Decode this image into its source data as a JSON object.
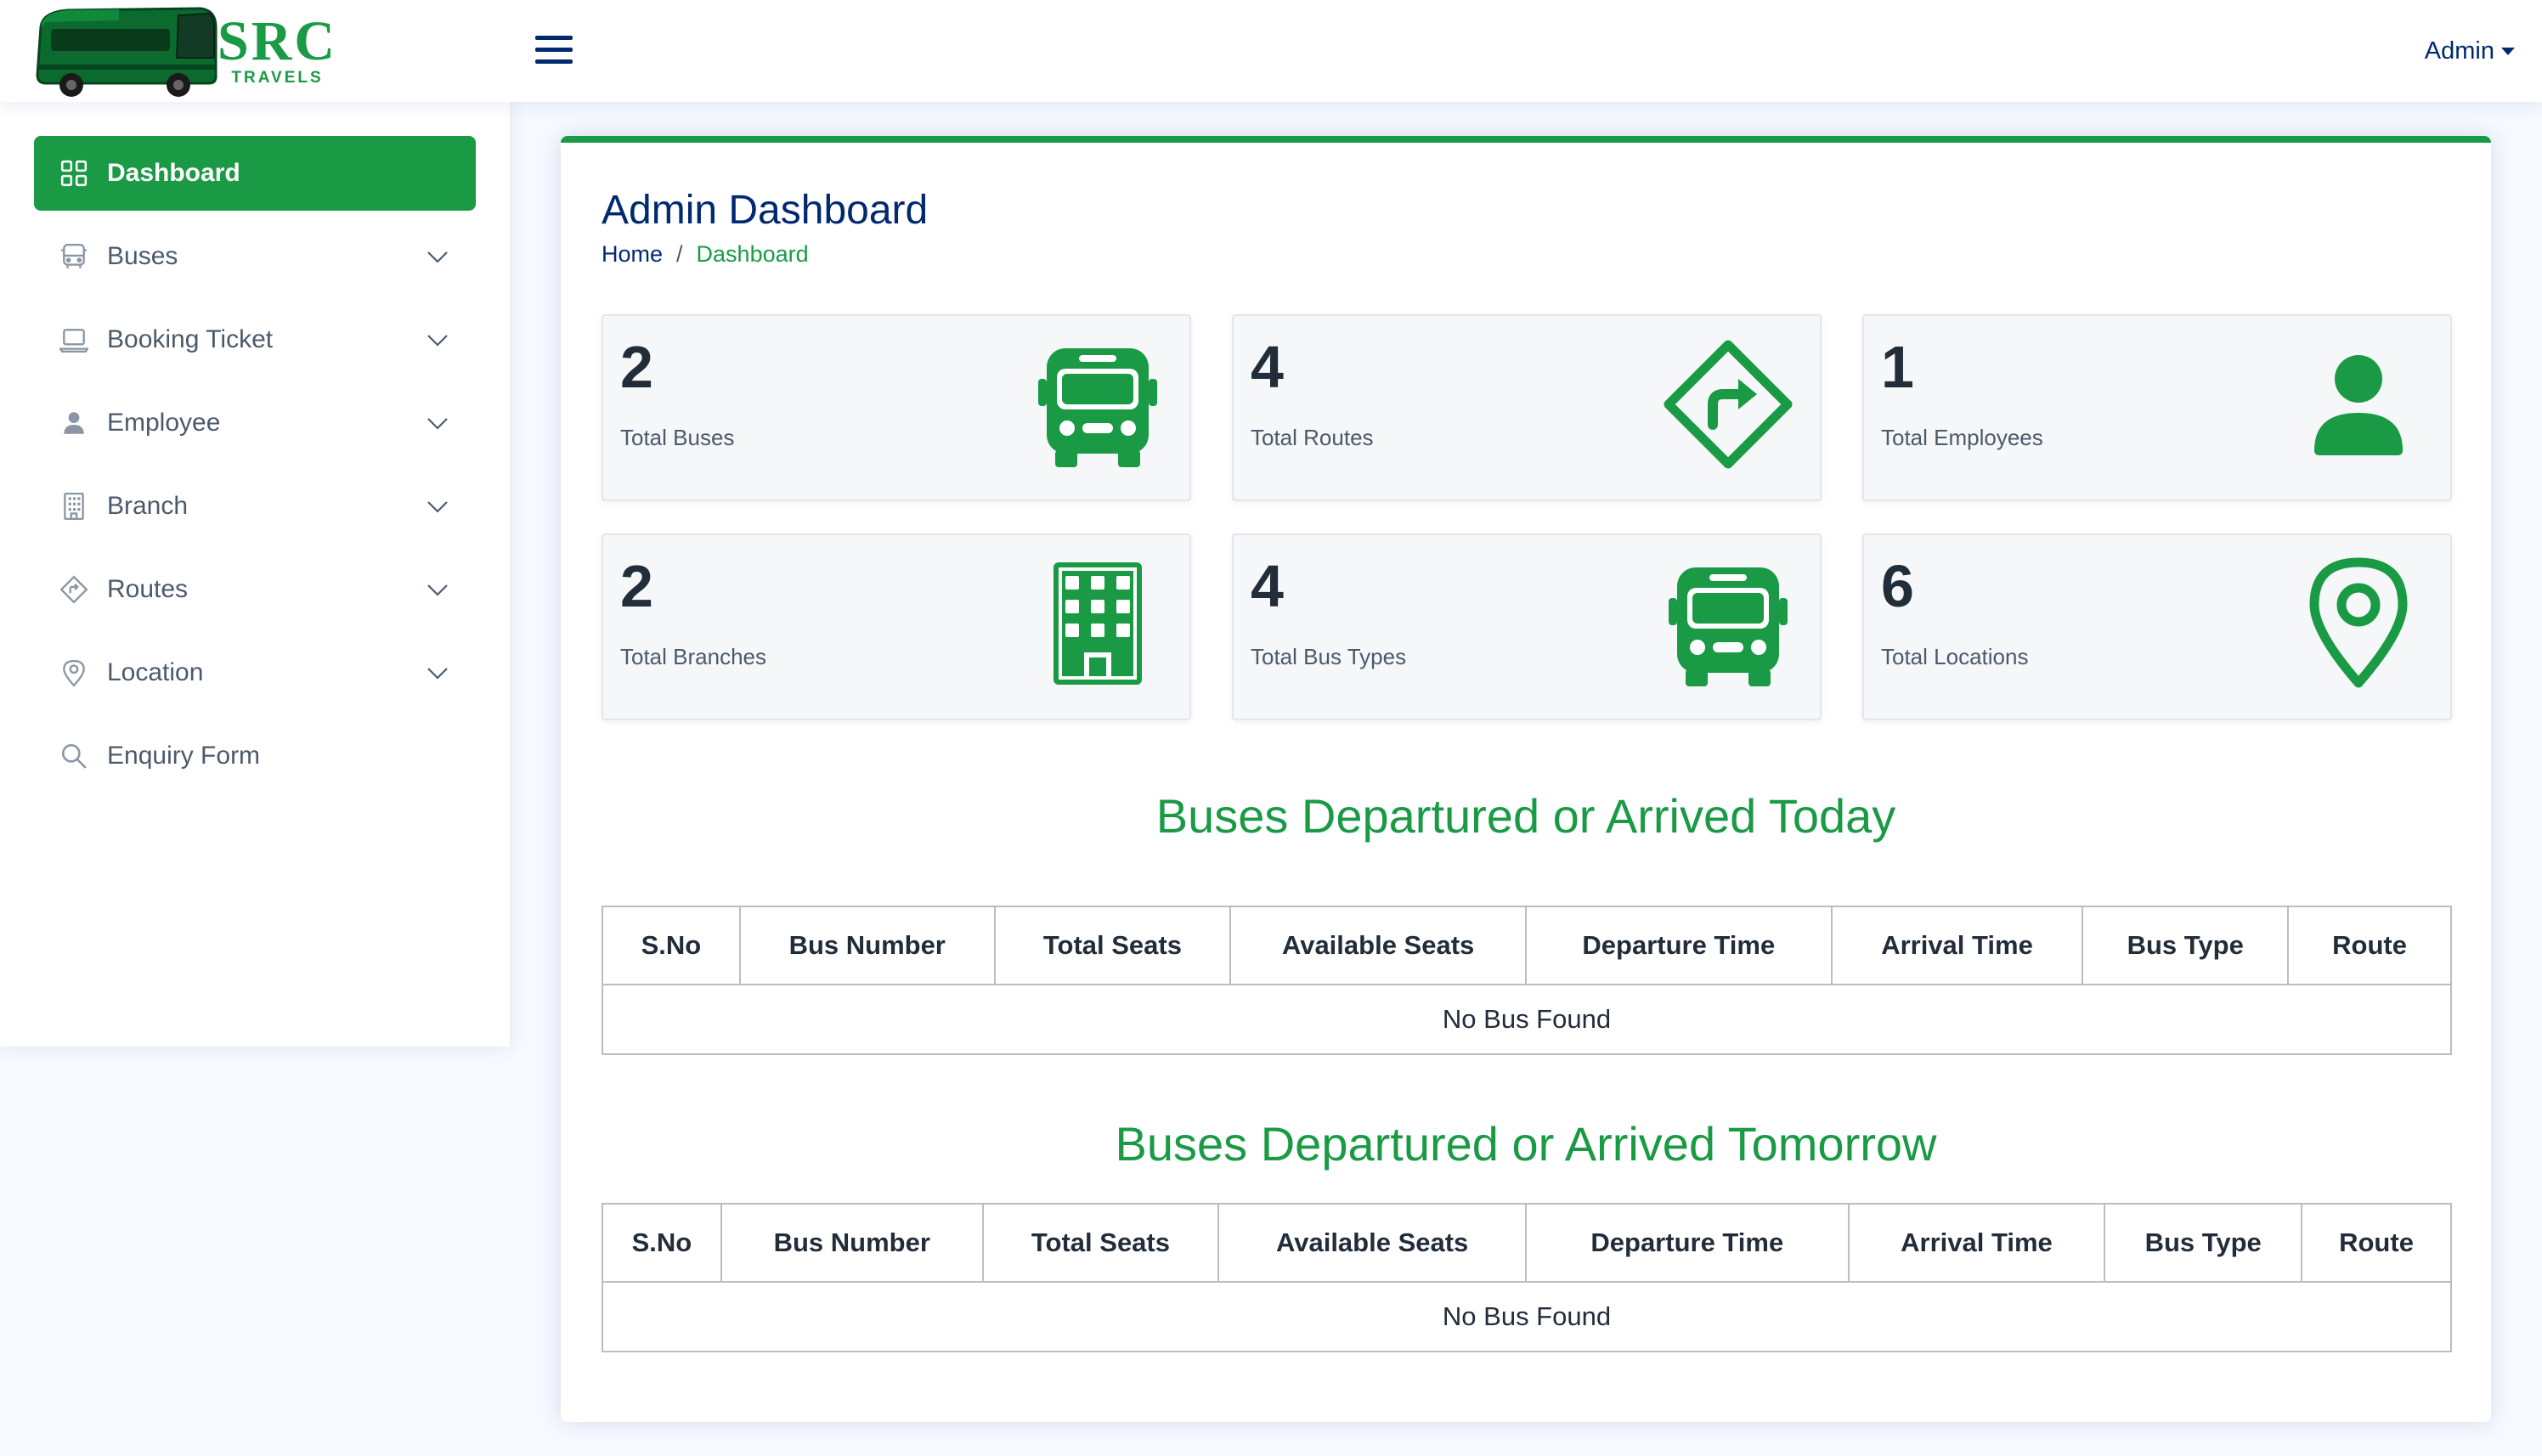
{
  "header": {
    "brand": "SRC",
    "tagline": "TRAVELS",
    "user_label": "Admin"
  },
  "sidebar": {
    "items": [
      {
        "label": "Dashboard",
        "icon": "grid-icon",
        "active": true,
        "has_chevron": false
      },
      {
        "label": "Buses",
        "icon": "bus-icon",
        "active": false,
        "has_chevron": true
      },
      {
        "label": "Booking Ticket",
        "icon": "laptop-icon",
        "active": false,
        "has_chevron": true
      },
      {
        "label": "Employee",
        "icon": "person-icon",
        "active": false,
        "has_chevron": true
      },
      {
        "label": "Branch",
        "icon": "building-icon",
        "active": false,
        "has_chevron": true
      },
      {
        "label": "Routes",
        "icon": "sign-turn-icon",
        "active": false,
        "has_chevron": true
      },
      {
        "label": "Location",
        "icon": "geo-pin-icon",
        "active": false,
        "has_chevron": true
      },
      {
        "label": "Enquiry Form",
        "icon": "search-icon",
        "active": false,
        "has_chevron": false
      }
    ]
  },
  "main": {
    "title": "Admin Dashboard",
    "breadcrumb": {
      "home": "Home",
      "separator": "/",
      "current": "Dashboard"
    },
    "stats": [
      {
        "count": "2",
        "label": "Total Buses",
        "icon": "bus-front-icon"
      },
      {
        "count": "4",
        "label": "Total Routes",
        "icon": "sign-turn-right-icon"
      },
      {
        "count": "1",
        "label": "Total Employees",
        "icon": "person-fill-icon"
      },
      {
        "count": "2",
        "label": "Total Branches",
        "icon": "building-fill-icon"
      },
      {
        "count": "4",
        "label": "Total Bus Types",
        "icon": "bus-front-icon"
      },
      {
        "count": "6",
        "label": "Total Locations",
        "icon": "geo-alt-icon"
      }
    ],
    "today": {
      "heading": "Buses Departured or Arrived Today",
      "columns": [
        "S.No",
        "Bus Number",
        "Total Seats",
        "Available Seats",
        "Departure Time",
        "Arrival Time",
        "Bus Type",
        "Route"
      ],
      "empty_message": "No Bus Found"
    },
    "tomorrow": {
      "heading": "Buses Departured or Arrived Tomorrow",
      "columns": [
        "S.No",
        "Bus Number",
        "Total Seats",
        "Available Seats",
        "Departure Time",
        "Arrival Time",
        "Bus Type",
        "Route"
      ],
      "empty_message": "No Bus Found"
    }
  },
  "colors": {
    "accent": "#1a9a45",
    "navy": "#012970",
    "background": "#f6f9ff"
  }
}
